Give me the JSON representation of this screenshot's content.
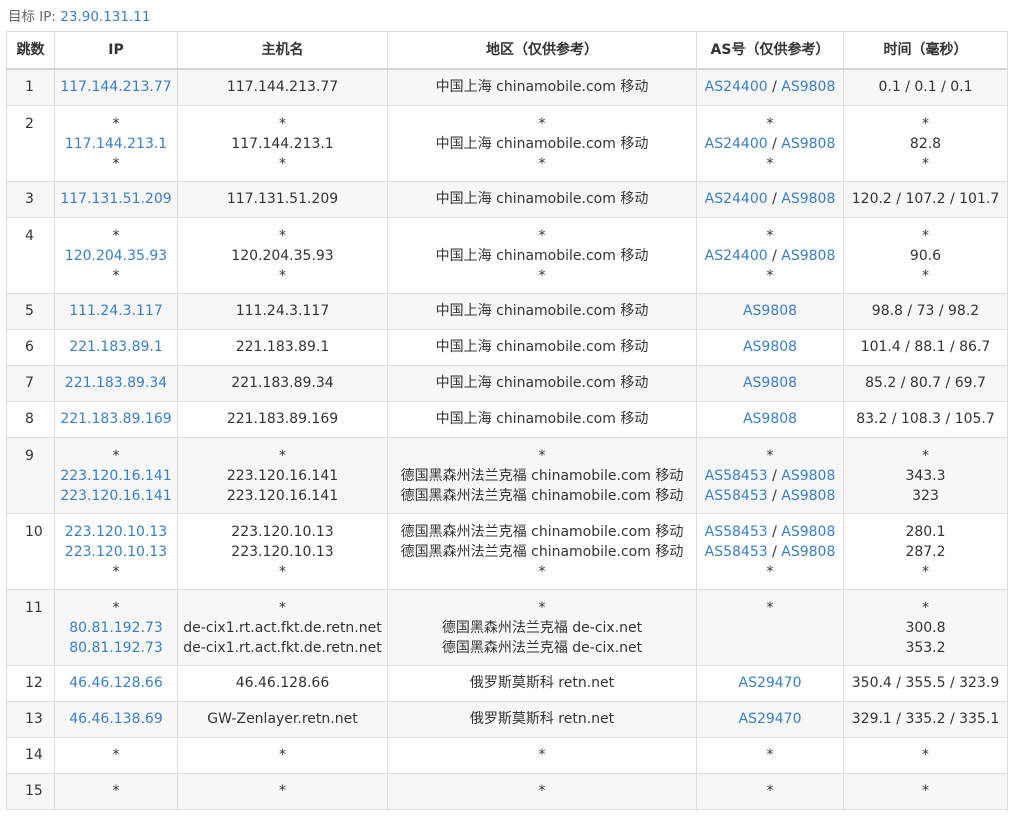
{
  "target": {
    "label": "目标 IP:",
    "ip": "23.90.131.11"
  },
  "headers": [
    "跳数",
    "IP",
    "主机名",
    "地区（仅供参考）",
    "AS号（仅供参考）",
    "时间（毫秒）"
  ],
  "rows": [
    {
      "hop": "1",
      "ip": [
        "117.144.213.77"
      ],
      "host": [
        "117.144.213.77"
      ],
      "region": [
        "中国上海 chinamobile.com 移动"
      ],
      "as": [
        [
          "AS24400",
          "AS9808"
        ]
      ],
      "time": [
        "0.1 / 0.1 / 0.1"
      ]
    },
    {
      "hop": "2",
      "ip": [
        "*",
        "117.144.213.1",
        "*"
      ],
      "host": [
        "*",
        "117.144.213.1",
        "*"
      ],
      "region": [
        "*",
        "中国上海 chinamobile.com 移动",
        "*"
      ],
      "as": [
        [
          "*"
        ],
        [
          "AS24400",
          "AS9808"
        ],
        [
          "*"
        ]
      ],
      "time": [
        "*",
        "82.8",
        "*"
      ]
    },
    {
      "hop": "3",
      "ip": [
        "117.131.51.209"
      ],
      "host": [
        "117.131.51.209"
      ],
      "region": [
        "中国上海 chinamobile.com 移动"
      ],
      "as": [
        [
          "AS24400",
          "AS9808"
        ]
      ],
      "time": [
        "120.2 / 107.2 / 101.7"
      ]
    },
    {
      "hop": "4",
      "ip": [
        "*",
        "120.204.35.93",
        "*"
      ],
      "host": [
        "*",
        "120.204.35.93",
        "*"
      ],
      "region": [
        "*",
        "中国上海 chinamobile.com 移动",
        "*"
      ],
      "as": [
        [
          "*"
        ],
        [
          "AS24400",
          "AS9808"
        ],
        [
          "*"
        ]
      ],
      "time": [
        "*",
        "90.6",
        "*"
      ]
    },
    {
      "hop": "5",
      "ip": [
        "111.24.3.117"
      ],
      "host": [
        "111.24.3.117"
      ],
      "region": [
        "中国上海 chinamobile.com 移动"
      ],
      "as": [
        [
          "AS9808"
        ]
      ],
      "time": [
        "98.8 / 73 / 98.2"
      ]
    },
    {
      "hop": "6",
      "ip": [
        "221.183.89.1"
      ],
      "host": [
        "221.183.89.1"
      ],
      "region": [
        "中国上海 chinamobile.com 移动"
      ],
      "as": [
        [
          "AS9808"
        ]
      ],
      "time": [
        "101.4 / 88.1 / 86.7"
      ]
    },
    {
      "hop": "7",
      "ip": [
        "221.183.89.34"
      ],
      "host": [
        "221.183.89.34"
      ],
      "region": [
        "中国上海 chinamobile.com 移动"
      ],
      "as": [
        [
          "AS9808"
        ]
      ],
      "time": [
        "85.2 / 80.7 / 69.7"
      ]
    },
    {
      "hop": "8",
      "ip": [
        "221.183.89.169"
      ],
      "host": [
        "221.183.89.169"
      ],
      "region": [
        "中国上海 chinamobile.com 移动"
      ],
      "as": [
        [
          "AS9808"
        ]
      ],
      "time": [
        "83.2 / 108.3 / 105.7"
      ]
    },
    {
      "hop": "9",
      "ip": [
        "*",
        "223.120.16.141",
        "223.120.16.141"
      ],
      "host": [
        "*",
        "223.120.16.141",
        "223.120.16.141"
      ],
      "region": [
        "*",
        "德国黑森州法兰克福 chinamobile.com 移动",
        "德国黑森州法兰克福 chinamobile.com 移动"
      ],
      "as": [
        [
          "*"
        ],
        [
          "AS58453",
          "AS9808"
        ],
        [
          "AS58453",
          "AS9808"
        ]
      ],
      "time": [
        "*",
        "343.3",
        "323"
      ]
    },
    {
      "hop": "10",
      "ip": [
        "223.120.10.13",
        "223.120.10.13",
        "*"
      ],
      "host": [
        "223.120.10.13",
        "223.120.10.13",
        "*"
      ],
      "region": [
        "德国黑森州法兰克福 chinamobile.com 移动",
        "德国黑森州法兰克福 chinamobile.com 移动",
        "*"
      ],
      "as": [
        [
          "AS58453",
          "AS9808"
        ],
        [
          "AS58453",
          "AS9808"
        ],
        [
          "*"
        ]
      ],
      "time": [
        "280.1",
        "287.2",
        "*"
      ]
    },
    {
      "hop": "11",
      "ip": [
        "*",
        "80.81.192.73",
        "80.81.192.73"
      ],
      "host": [
        "*",
        "de-cix1.rt.act.fkt.de.retn.net",
        "de-cix1.rt.act.fkt.de.retn.net"
      ],
      "region": [
        "*",
        "德国黑森州法兰克福 de-cix.net",
        "德国黑森州法兰克福 de-cix.net"
      ],
      "as": [
        [
          "*"
        ]
      ],
      "time": [
        "*",
        "300.8",
        "353.2"
      ]
    },
    {
      "hop": "12",
      "ip": [
        "46.46.128.66"
      ],
      "host": [
        "46.46.128.66"
      ],
      "region": [
        "俄罗斯莫斯科 retn.net"
      ],
      "as": [
        [
          "AS29470"
        ]
      ],
      "time": [
        "350.4 / 355.5 / 323.9"
      ]
    },
    {
      "hop": "13",
      "ip": [
        "46.46.138.69"
      ],
      "host": [
        "GW-Zenlayer.retn.net"
      ],
      "region": [
        "俄罗斯莫斯科 retn.net"
      ],
      "as": [
        [
          "AS29470"
        ]
      ],
      "time": [
        "329.1 / 335.2 / 335.1"
      ]
    },
    {
      "hop": "14",
      "ip": [
        "*"
      ],
      "host": [
        "*"
      ],
      "region": [
        "*"
      ],
      "as": [
        [
          "*"
        ]
      ],
      "time": [
        "*"
      ]
    },
    {
      "hop": "15",
      "ip": [
        "*"
      ],
      "host": [
        "*"
      ],
      "region": [
        "*"
      ],
      "as": [
        [
          "*"
        ]
      ],
      "time": [
        "*"
      ]
    }
  ]
}
